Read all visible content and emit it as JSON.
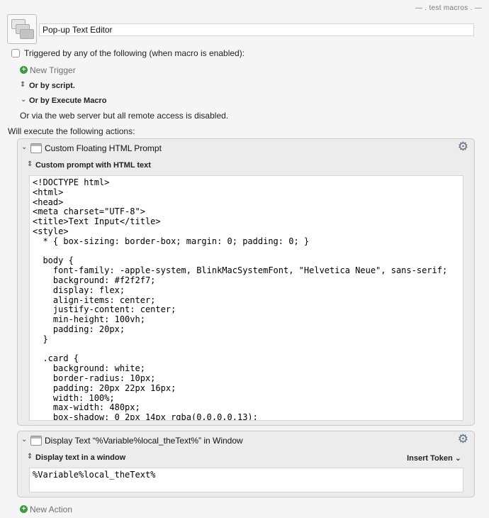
{
  "header": {
    "group_label": "— . test macros . —",
    "macro_name": "Pop-up Text Editor"
  },
  "triggers": {
    "triggered_label": "Triggered by any of the following (when macro is enabled):",
    "new_trigger": "New Trigger",
    "or_script": "Or by script.",
    "or_execute": "Or by Execute Macro",
    "web_server": "Or via the web server but all remote access is disabled."
  },
  "actions": {
    "intro": "Will execute the following actions:",
    "action1": {
      "title": "Custom Floating HTML Prompt",
      "sub_label": "Custom prompt with HTML text",
      "code": "<!DOCTYPE html>\n<html>\n<head>\n<meta charset=\"UTF-8\">\n<title>Text Input</title>\n<style>\n  * { box-sizing: border-box; margin: 0; padding: 0; }\n\n  body {\n    font-family: -apple-system, BlinkMacSystemFont, \"Helvetica Neue\", sans-serif;\n    background: #f2f2f7;\n    display: flex;\n    align-items: center;\n    justify-content: center;\n    min-height: 100vh;\n    padding: 20px;\n  }\n\n  .card {\n    background: white;\n    border-radius: 10px;\n    padding: 20px 22px 16px;\n    width: 100%;\n    max-width: 480px;\n    box-shadow: 0 2px 14px rgba(0,0,0,0.13);"
    },
    "action2": {
      "title": "Display Text “%Variable%local_theText%” in Window",
      "sub_label": "Display text in a window",
      "insert_token": "Insert Token",
      "text": "%Variable%local_theText%"
    },
    "new_action": "New Action"
  },
  "icons": {
    "disclosure": "chevron-down-icon",
    "gear": "gear-icon",
    "add": "plus-circle-icon",
    "updown": "up-down-chevron-icon"
  },
  "colors": {
    "add_green": "#3d9b3d",
    "gear_blue": "#5f6f80"
  }
}
